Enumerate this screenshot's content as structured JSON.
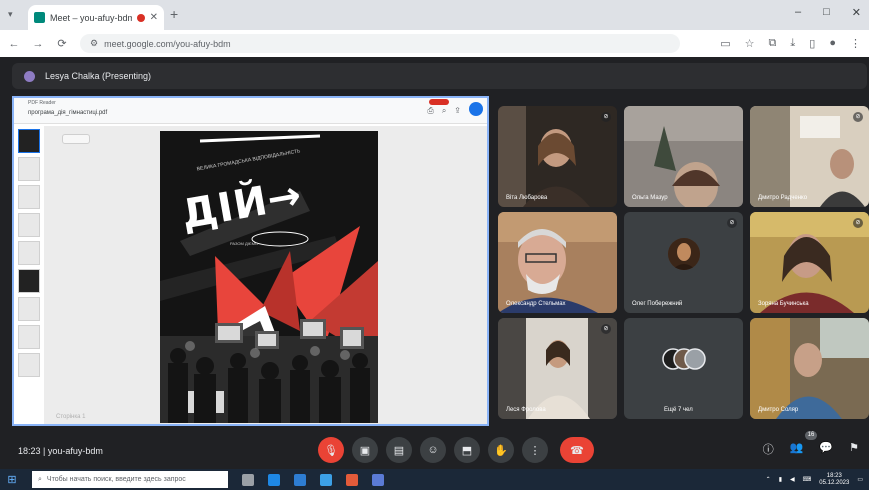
{
  "browser": {
    "tab_title": "Meet – you-afuy-bdm",
    "url": "meet.google.com/you-afuy-bdm",
    "win_min": "–",
    "win_max": "□",
    "win_close": "✕"
  },
  "presenter": {
    "name": "Lesya Chalka (Presenting)"
  },
  "shared_doc": {
    "filename": "програма_дія_гімнастиці.pdf",
    "header_small": "PDF Reader",
    "page_label": "Сторінка 1",
    "poster_title": "ДІЙ→",
    "poster_subtitle": "ВЕЛИКА ГРОМАДСЬКА ВІДПОВІДАЛЬНІСТЬ",
    "poster_text": "РАЗОМ ДІЄМО"
  },
  "participants": [
    {
      "name": "Віта Любарова",
      "muted": true
    },
    {
      "name": "Ольга Мазур",
      "muted": false
    },
    {
      "name": "Дмитро Радченко",
      "muted": true
    },
    {
      "name": "Олександр Стельмах",
      "muted": false
    },
    {
      "name": "Олег Побережний",
      "muted": true
    },
    {
      "name": "Зоряна Бучинська",
      "muted": true
    },
    {
      "name": "Леся Фролова",
      "muted": true
    },
    {
      "name": "Ещё 7 чел",
      "muted": false
    },
    {
      "name": "Дмитро Соляр",
      "muted": false
    }
  ],
  "meeting": {
    "time": "18:23",
    "code": "you-afuy-bdm",
    "participant_count": "16"
  },
  "taskbar": {
    "search_placeholder": "Чтобы начать поиск, введите здесь запрос",
    "time": "18:23",
    "date": "05.12.2023"
  },
  "colors": {
    "meet_bg": "#202124",
    "end_call": "#ea4335",
    "presenting_border": "#8ab4f8"
  }
}
